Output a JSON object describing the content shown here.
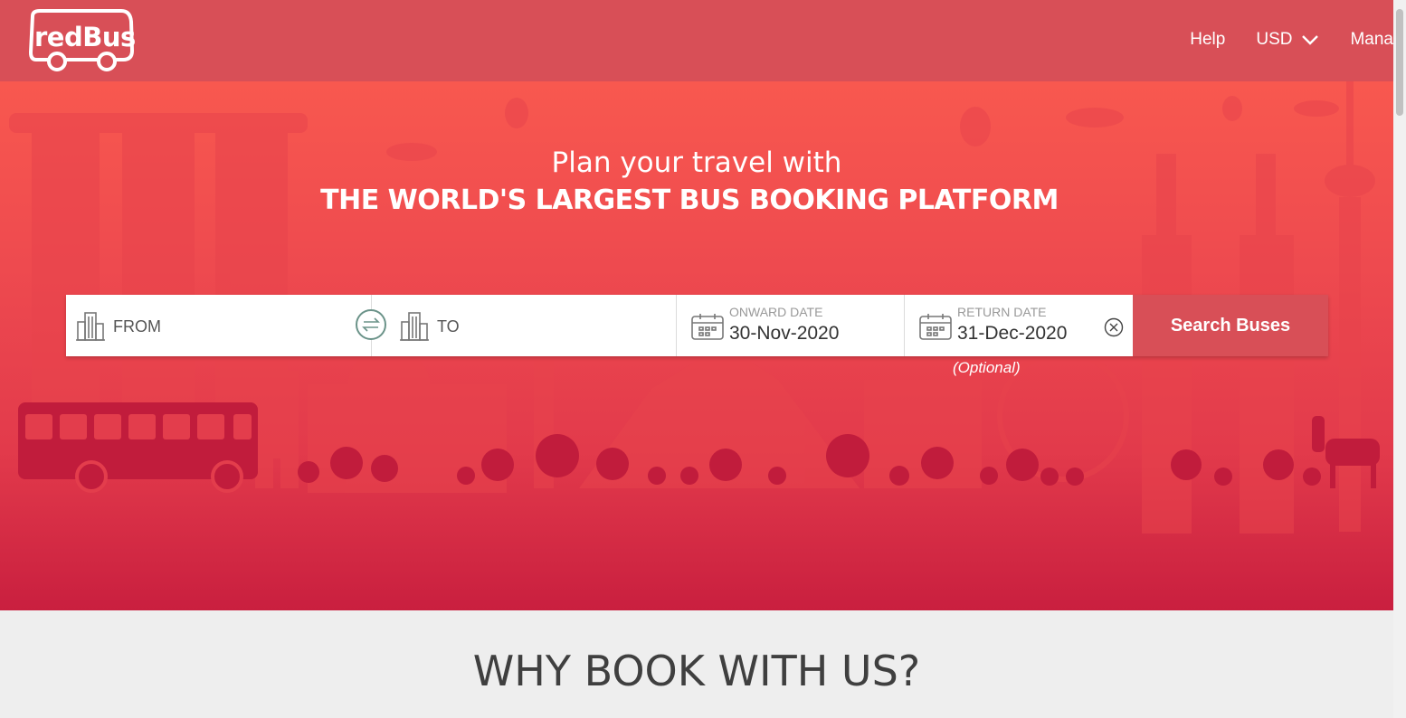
{
  "header": {
    "logo_text": "redBus",
    "nav": [
      {
        "label": "Help"
      },
      {
        "label": "USD"
      },
      {
        "label": "Mana"
      }
    ]
  },
  "hero": {
    "line1": "Plan your travel with",
    "line2": "THE WORLD'S LARGEST BUS BOOKING PLATFORM"
  },
  "search": {
    "from_placeholder": "FROM",
    "to_placeholder": "TO",
    "onward_label": "ONWARD DATE",
    "onward_value": "30-Nov-2020",
    "return_label": "RETURN DATE",
    "return_value": "31-Dec-2020",
    "return_optional": "(Optional)",
    "button_label": "Search Buses"
  },
  "why": {
    "title": "WHY BOOK WITH US?"
  },
  "colors": {
    "brand": "#d84f57",
    "hero_top": "#f8584f",
    "hero_bottom": "#c91f3f"
  }
}
